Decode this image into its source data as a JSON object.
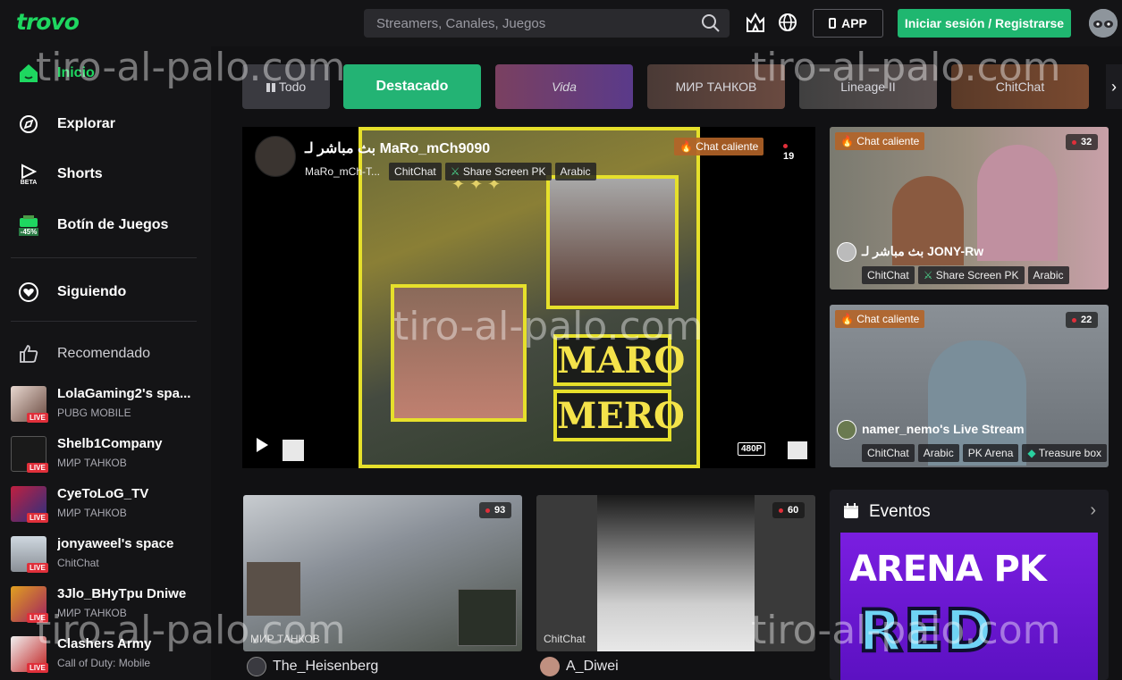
{
  "header": {
    "logo": "trovo",
    "search_placeholder": "Streamers, Canales, Juegos",
    "app_label": "APP",
    "login_label": "Iniciar sesión / Registrarse",
    "icons": [
      "search-icon",
      "castle-icon",
      "globe-icon",
      "phone-icon",
      "avatar"
    ]
  },
  "sidebar": {
    "nav": [
      {
        "label": "Inicio",
        "icon": "home-icon",
        "active": true
      },
      {
        "label": "Explorar",
        "icon": "explore-icon"
      },
      {
        "label": "Shorts",
        "icon": "shorts-icon",
        "badge": "BETA"
      },
      {
        "label": "Botín de Juegos",
        "icon": "loot-icon",
        "badge": "-45%"
      },
      {
        "label": "Siguiendo",
        "icon": "heart-icon"
      }
    ],
    "recommended_label": "Recomendado",
    "channels": [
      {
        "name": "LolaGaming2's spa...",
        "game": "PUBG MOBILE",
        "live": "LIVE"
      },
      {
        "name": "Shelb1Company",
        "game": "МИР ТАНКОВ",
        "live": "LIVE"
      },
      {
        "name": "CyeToLoG_TV",
        "game": "МИР ТАНКОВ",
        "live": "LIVE"
      },
      {
        "name": "jonyaweel's space",
        "game": "ChitChat",
        "live": "LIVE"
      },
      {
        "name": "3Jlo_BHyTpu Dniwe",
        "game": "МИР ТАНКОВ",
        "live": "LIVE"
      },
      {
        "name": "Clashers Army",
        "game": "Call of Duty: Mobile",
        "live": "LIVE"
      }
    ]
  },
  "tabs": [
    "Todo",
    "Destacado",
    "Vida",
    "МИР ТАНКОВ",
    "Lineage II",
    "ChitChat"
  ],
  "featured": {
    "title": "بث مباشر لـ MaRo_mCh9090",
    "channel_short": "MaRo_mCh-T...",
    "tags": [
      "ChitChat",
      "Share Screen PK",
      "Arabic"
    ],
    "hot_badge": "Chat caliente",
    "viewers": "19",
    "quality": "480P",
    "overlay_text_1": "MARO",
    "overlay_text_2": "MERO"
  },
  "side_cards": [
    {
      "title": "بث مباشر لـ JONY-Rw",
      "tags": [
        "ChitChat",
        "Share Screen PK",
        "Arabic"
      ],
      "hot_badge": "Chat caliente",
      "viewers": "32"
    },
    {
      "title": "namer_nemo's Live Stream",
      "tags": [
        "ChitChat",
        "Arabic",
        "PK Arena",
        "Treasure box"
      ],
      "hot_badge": "Chat caliente",
      "viewers": "22"
    }
  ],
  "bottom_cards": [
    {
      "game": "МИР ТАНКОВ",
      "streamer": "The_Heisenberg",
      "viewers": "93"
    },
    {
      "game": "ChitChat",
      "streamer": "A_Diwei",
      "viewers": "60"
    }
  ],
  "events": {
    "title": "Eventos",
    "banner_line1": "ARENA PK",
    "banner_line2": "RED"
  },
  "watermark": "tiro-al-palo.com"
}
